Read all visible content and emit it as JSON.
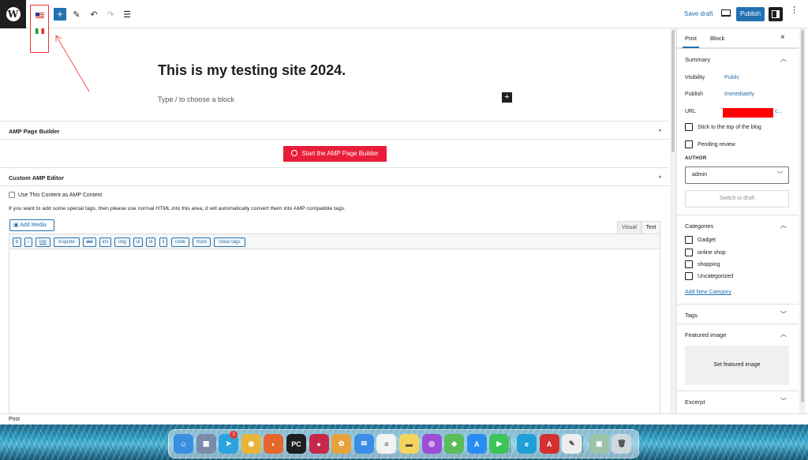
{
  "toolbar": {
    "save_draft": "Save draft",
    "publish": "Publish",
    "add_icon": "+",
    "tools_icon": "✎",
    "undo_icon": "↶",
    "redo_icon": "↷",
    "outline_icon": "☰",
    "options_icon": "⋮"
  },
  "language_switcher": {
    "languages": [
      "en-US flag",
      "it flag"
    ]
  },
  "post": {
    "title": "This is my testing site 2024.",
    "block_placeholder": "Type / to choose a block",
    "add_block_icon": "+"
  },
  "amp_page_builder": {
    "title": "AMP Page Builder",
    "start_button": "Start the AMP Page Builder",
    "caret": "▲"
  },
  "custom_amp_editor": {
    "title": "Custom AMP Editor",
    "caret": "▲",
    "checkbox_label": "Use This Content as AMP Content",
    "description": "If you want to add some special tags, then please use normal HTML into this area, it will automatically convert them into AMP compatible tags.",
    "add_media": "Add Media",
    "tab_visual": "Visual",
    "tab_text": "Text",
    "quicktags": [
      "b",
      "i",
      "link",
      "b-quote",
      "del",
      "ins",
      "img",
      "ul",
      "ol",
      "li",
      "code",
      "more",
      "close tags"
    ]
  },
  "sidebar": {
    "tab_post": "Post",
    "tab_block": "Block",
    "close": "×",
    "summary": {
      "title": "Summary",
      "visibility_label": "Visibility",
      "visibility_value": "Public",
      "publish_label": "Publish",
      "publish_value": "Immediately",
      "url_label": "URL",
      "url_suffix": "c...",
      "sticky": "Stick to the top of the blog",
      "pending": "Pending review",
      "author_label": "AUTHOR",
      "author_value": "admin",
      "switch_draft": "Switch to draft"
    },
    "categories": {
      "title": "Categories",
      "items": [
        "Gadget",
        "online shop",
        "shopping",
        "Uncategorized"
      ],
      "add_new": "Add New Category"
    },
    "tags": {
      "title": "Tags"
    },
    "featured_image": {
      "title": "Featured image",
      "set_label": "Set featured image"
    },
    "excerpt": {
      "title": "Excerpt"
    }
  },
  "footer": {
    "breadcrumb": "Post"
  },
  "dock": {
    "badge": "1",
    "apps": [
      {
        "name": "finder",
        "color": "#3b8fe0",
        "glyph": "☺"
      },
      {
        "name": "launchpad",
        "color": "#7a8aa8",
        "glyph": "▦"
      },
      {
        "name": "telegram",
        "color": "#2aa3e0",
        "glyph": "➤"
      },
      {
        "name": "chrome",
        "color": "#e8b43a",
        "glyph": "◉"
      },
      {
        "name": "firefox",
        "color": "#e5672a",
        "glyph": "◐"
      },
      {
        "name": "pycharm",
        "color": "#1d1d1d",
        "glyph": "PC"
      },
      {
        "name": "screen-recorder",
        "color": "#c62848",
        "glyph": "●"
      },
      {
        "name": "photos",
        "color": "#e9a23b",
        "glyph": "✿"
      },
      {
        "name": "mail",
        "color": "#3a8ee6",
        "glyph": "✉"
      },
      {
        "name": "reminders",
        "color": "#f2f2f2",
        "glyph": "≡"
      },
      {
        "name": "notes",
        "color": "#f4d35e",
        "glyph": "▬"
      },
      {
        "name": "podcasts",
        "color": "#9c4fd6",
        "glyph": "◎"
      },
      {
        "name": "maps",
        "color": "#5bbd5a",
        "glyph": "◆"
      },
      {
        "name": "app-store",
        "color": "#2a8cf0",
        "glyph": "A"
      },
      {
        "name": "facetime",
        "color": "#3cc45a",
        "glyph": "▶"
      },
      {
        "name": "edge",
        "color": "#1f9fd6",
        "glyph": "e"
      },
      {
        "name": "acrobat",
        "color": "#d32f2f",
        "glyph": "A"
      },
      {
        "name": "textedit",
        "color": "#eeeeee",
        "glyph": "✎"
      },
      {
        "name": "preview",
        "color": "#9bc3a5",
        "glyph": "▣"
      },
      {
        "name": "trash",
        "color": "#cfd8dc",
        "glyph": "🗑"
      }
    ]
  }
}
